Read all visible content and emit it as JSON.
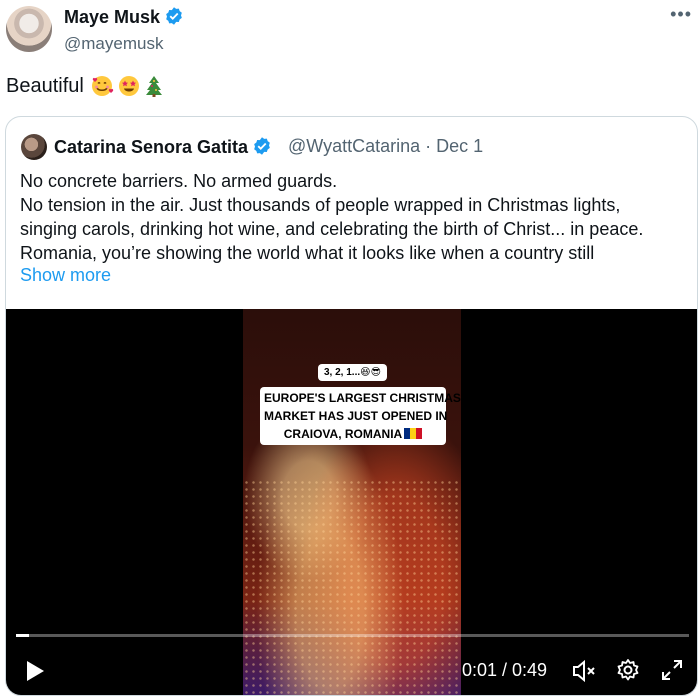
{
  "tweet": {
    "author_name": "Maye Musk",
    "author_handle": "@mayemusk",
    "text": "Beautiful",
    "emojis": [
      "smiling-face-with-hearts",
      "star-struck",
      "christmas-tree"
    ]
  },
  "quote": {
    "author_name": "Catarina Senora Gatita",
    "author_handle_date": "@WyattCatarina · Dec 1",
    "body_lines": [
      "No concrete barriers. No armed guards.",
      "No tension in the air.  Just thousands of people wrapped in Christmas lights,",
      "singing carols, drinking hot wine, and celebrating the birth of Christ... in peace.",
      "Romania, you’re showing the world what it looks like when a country still"
    ],
    "show_more": "Show more"
  },
  "video": {
    "caption_small": "3, 2, 1...",
    "caption_lines": [
      "EUROPE'S LARGEST CHRISTMAS",
      "MARKET HAS JUST OPENED IN",
      "CRAIOVA, ROMANIA"
    ],
    "time": "0:01 / 0:49",
    "progress": 0.02
  },
  "colors": {
    "link": "#1d9bf0",
    "verified": "#1d9bf0",
    "muted": "#536471"
  }
}
